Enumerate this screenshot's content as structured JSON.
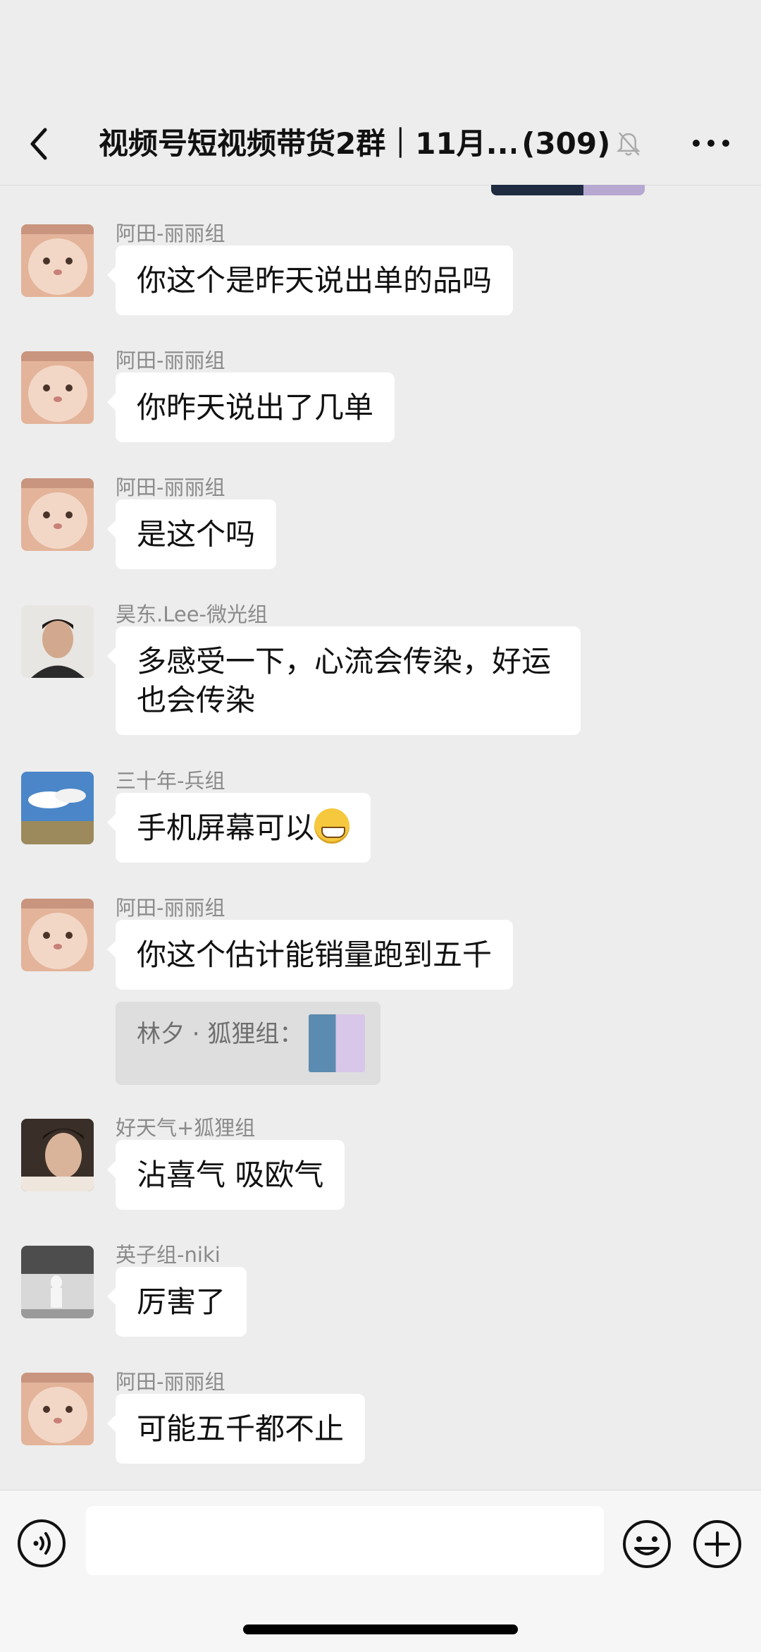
{
  "header": {
    "title": "视频号短视频带货2群｜11月...",
    "member_count": "(309)",
    "muted_icon": "bell-off-icon",
    "back_icon": "chevron-left-icon",
    "more_icon": "more-dots-icon"
  },
  "messages": [
    {
      "sender": "阿田-丽丽组",
      "text": "你这个是昨天说出单的品吗",
      "avatar": "cat-avatar"
    },
    {
      "sender": "阿田-丽丽组",
      "text": "你昨天说出了几单",
      "avatar": "cat-avatar"
    },
    {
      "sender": "阿田-丽丽组",
      "text": "是这个吗",
      "avatar": "cat-avatar"
    },
    {
      "sender": "昊东.Lee-微光组",
      "text": "多感受一下，心流会传染，好运也会传染",
      "avatar": "person-avatar"
    },
    {
      "sender": "三十年-兵组",
      "text": "手机屏幕可以",
      "emoji": "grinning-face-emoji",
      "avatar": "sky-avatar"
    },
    {
      "sender": "阿田-丽丽组",
      "text": "你这个估计能销量跑到五千",
      "avatar": "cat-avatar"
    },
    {
      "sender": "好天气+狐狸组",
      "text": "沾喜气 吸欧气",
      "avatar": "portrait-avatar"
    },
    {
      "sender": "英子组-niki",
      "text": "厉害了",
      "avatar": "bw-photo-avatar"
    },
    {
      "sender": "阿田-丽丽组",
      "text": "可能五千都不止",
      "avatar": "cat-avatar"
    }
  ],
  "quote": {
    "text": "林夕 · 狐狸组："
  },
  "input_bar": {
    "placeholder": "",
    "voice_icon": "voice-icon",
    "emoji_icon": "emoji-icon",
    "plus_icon": "plus-icon"
  },
  "colors": {
    "background": "#ededed",
    "bubble": "#ffffff",
    "sender_text": "#8a8a8a"
  }
}
